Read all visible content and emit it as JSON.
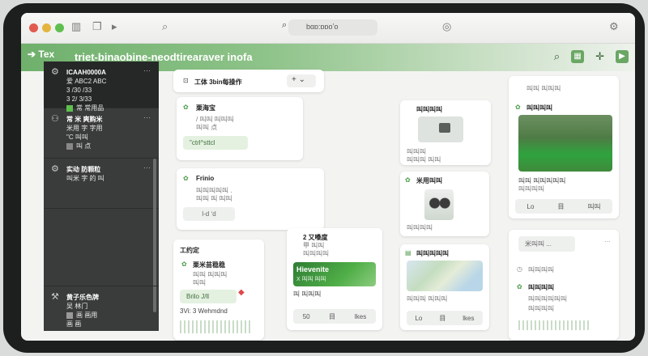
{
  "window": {
    "address": "bɑɒ:ɒɒoʼo"
  },
  "app": {
    "logo": "Tex",
    "title": "triet-binaobine-neodtirearaver inofa"
  },
  "sidebar": {
    "items": [
      {
        "title": "ICAAH0000A",
        "line1": "爱 ABC2 ABC",
        "line2": "3 /30 /33",
        "line3": "3 2/ 3/33",
        "status": "常 常用品"
      },
      {
        "title": "常 米 爽购米",
        "line1": "米用 字 字用",
        "line2": "\"C 叫叫",
        "status": "叫 点"
      },
      {
        "title": "实动 防颗粒",
        "line1": "叫米 字 的 叫",
        "line2": ""
      }
    ],
    "bottom": {
      "title": "黄子乐色牌",
      "line1": "吴 林门 ",
      "line2": "画 画用",
      "line3": "画 画"
    }
  },
  "col1": {
    "header": {
      "title": "工体 3bin每操作",
      "plus": "+",
      "chev": "⌄"
    },
    "card1": {
      "title": "栗海宝",
      "line1": "/ 叫叫 叫叫叫 ",
      "line2": "叫叫 点",
      "pill": "\"ctrl^sttcl"
    },
    "card2": {
      "title": "Frinio",
      "line1": "叫叫叫叫叫 .",
      "line2": "叫叫 叫 叫叫",
      "pill": "l-d  ʻd"
    }
  },
  "col1b": {
    "title": "工约定",
    "sub": "栗米苗稳稳",
    "line1": "叫叫 叫叫叫",
    "line2": "叫叫",
    "pill": "Brilo J/ll",
    "caption": "3Vi: 3 Wehmdnd"
  },
  "col2": {
    "card": {
      "title": "2  又嗓度",
      "sub": "甲 叫叫",
      "line1": "叫叫叫叫",
      "img_text": "Hievenite",
      "img_sub": "X 叫叫 叫叫",
      "caption": "叫 叫叫叫",
      "btn1": "50",
      "btn2": "目",
      "btn3": "Ikes"
    }
  },
  "col3": {
    "card1": {
      "title": "叫叫叫叫",
      "line1": "叫叫叫",
      "line2": "叫叫叫 叫叫"
    },
    "card2": {
      "title": "米用叫叫",
      "line1": "叫叫叫叫"
    },
    "card3": {
      "title": "叫叫叫叫叫",
      "line1": "叫叫叫 叫叫叫",
      "btn1": "Lo",
      "btn2": "目",
      "btn3": "lkes"
    }
  },
  "col4": {
    "card1": {
      "title": "叫叫 叫叫叫",
      "sub": "叫叫叫叫",
      "line1": "叫叫 叫叫叫叫叫",
      "line2": "叫叫叫叫",
      "btn1": "Lo",
      "btn2": "目",
      "btn3": "叫叫"
    },
    "card2": {
      "pill": "米叫叫 ...",
      "title": "叫叫叫叫",
      "sub": "叫叫叫叫",
      "line1": "叫叫叫叫叫叫",
      "line2": "叫叫叫叫"
    }
  }
}
